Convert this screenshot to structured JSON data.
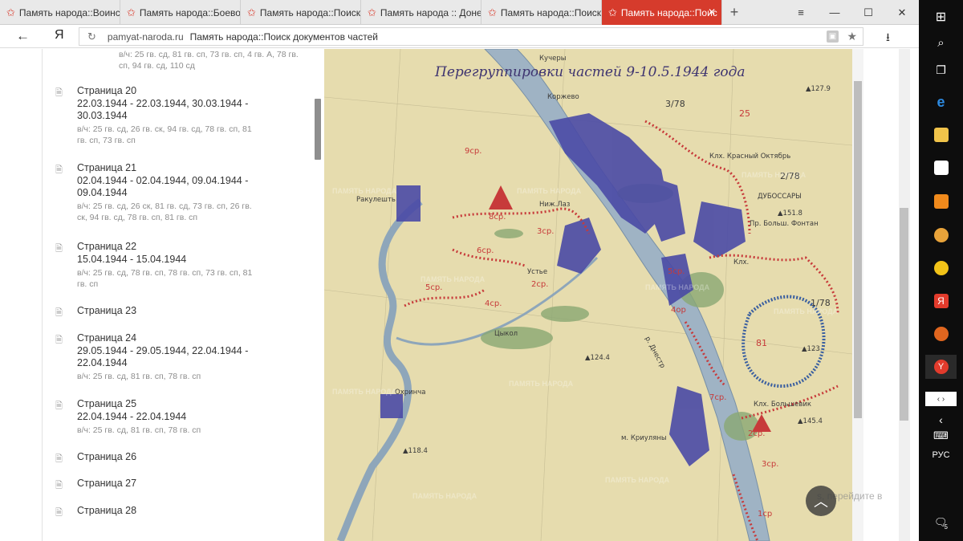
{
  "tabs": [
    {
      "label": "Память народа::Воинск",
      "active": false
    },
    {
      "label": "Память народа::Боевое",
      "active": false
    },
    {
      "label": "Память народа::Поиск",
      "active": false
    },
    {
      "label": "Память народа :: Донес",
      "active": false
    },
    {
      "label": "Память народа::Поиск",
      "active": false
    },
    {
      "label": "Память народа::Поис",
      "active": true
    }
  ],
  "address": {
    "domain": "pamyat-naroda.ru",
    "title": "Память народа::Поиск документов частей"
  },
  "browser_logo": "Я",
  "top_units": "в/ч: 25 гв. сд, 81 гв. сп, 73 гв. сп, 4 гв. А, 78 гв. сп, 94 гв. сд, 110 сд",
  "pages": [
    {
      "title": "Страница 20",
      "dates": "22.03.1944 - 22.03.1944, 30.03.1944 - 30.03.1944",
      "units": "в/ч: 25 гв. сд, 26 гв. ск, 94 гв. сд, 78 гв. сп, 81 гв. сп, 73 гв. сп"
    },
    {
      "title": "Страница 21",
      "dates": "02.04.1944 - 02.04.1944, 09.04.1944 - 09.04.1944",
      "units": "в/ч: 25 гв. сд, 26 ск, 81 гв. сд, 73 гв. сп, 26 гв. ск, 94 гв. сд, 78 гв. сп, 81 гв. сп"
    },
    {
      "title": "Страница 22",
      "dates": "15.04.1944 - 15.04.1944",
      "units": "в/ч: 25 гв. сд, 78 гв. сп, 78 гв. сп, 73 гв. сп, 81 гв. сп"
    },
    {
      "title": "Страница 23",
      "dates": "",
      "units": ""
    },
    {
      "title": "Страница 24",
      "dates": "29.05.1944 - 29.05.1944, 22.04.1944 - 22.04.1944",
      "units": "в/ч: 25 гв. сд, 81 гв. сп, 78 гв. сп"
    },
    {
      "title": "Страница 25",
      "dates": "22.04.1944 - 22.04.1944",
      "units": "в/ч: 25 гв. сд, 81 гв. сп, 78 гв. сп"
    },
    {
      "title": "Страница 26",
      "dates": "",
      "units": ""
    },
    {
      "title": "Страница 27",
      "dates": "",
      "units": ""
    },
    {
      "title": "Страница 28",
      "dates": "",
      "units": ""
    }
  ],
  "map": {
    "title": "Перегруппировки частей 9-10.5.1944 года",
    "watermark": "ПАМЯТЬ НАРОДА",
    "labels": [
      "Кучеры",
      "Коржево",
      "3/78",
      "25",
      "Клх. Красный Октябрь",
      "2/78",
      "ДУБОССАРЫ",
      "Пр. Больш. Фонтан",
      "Ракулешть",
      "8ср.",
      "9ср.",
      "3ср.",
      "6ср.",
      "Устье",
      "2ср.",
      "5ср.",
      "4ср.",
      "5ср.",
      "4ор",
      "Клх.",
      "1/78",
      "81",
      "Клх. Большевик",
      "Охринча",
      "м. Криуляны",
      "▲124.4",
      "▲127.9",
      "▲123",
      "▲118.4",
      "▲151.8",
      "▲145.4",
      "7ср.",
      "2ср.",
      "3ср.",
      "1ср",
      "Ниж.Лаз",
      "Цыкол",
      "р. Днестр"
    ]
  },
  "ghost_text": "s, перейдите в",
  "taskbar": {
    "lang": "РУС",
    "notif_count": "5"
  },
  "colors": {
    "active_tab": "#d63b2c",
    "map_paper": "#e8ddb0",
    "map_blue": "#4a4aa6",
    "map_red": "#c73a3a",
    "map_river": "#9fb3c4",
    "map_green": "#8aa873"
  }
}
